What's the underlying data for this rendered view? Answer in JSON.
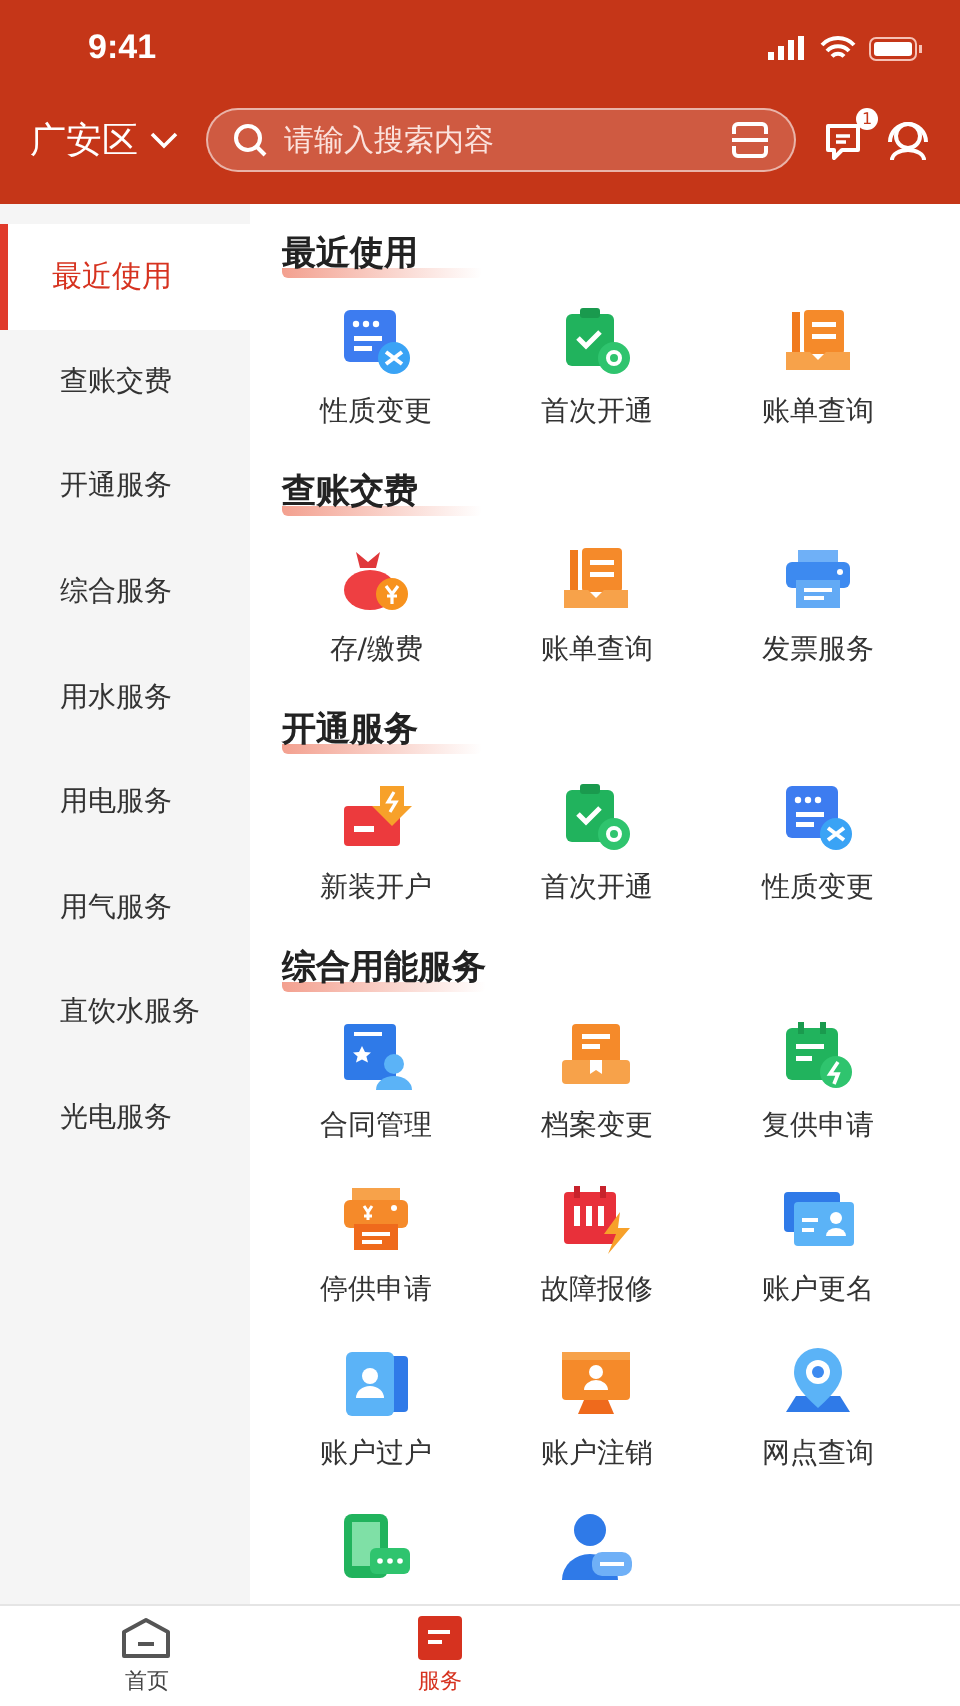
{
  "status_bar": {
    "time": "9:41"
  },
  "header": {
    "location": "广安区",
    "search": {
      "placeholder": "请输入搜索内容"
    },
    "message_badge": "1"
  },
  "sidebar": {
    "items": [
      {
        "label": "最近使用",
        "selected": true
      },
      {
        "label": "查账交费",
        "selected": false
      },
      {
        "label": "开通服务",
        "selected": false
      },
      {
        "label": "综合服务",
        "selected": false
      },
      {
        "label": "用水服务",
        "selected": false
      },
      {
        "label": "用电服务",
        "selected": false
      },
      {
        "label": "用气服务",
        "selected": false
      },
      {
        "label": "直饮水服务",
        "selected": false
      },
      {
        "label": "光电服务",
        "selected": false
      }
    ]
  },
  "sections": [
    {
      "title": "最近使用",
      "items": [
        {
          "label": "性质变更",
          "kind": "swap"
        },
        {
          "label": "首次开通",
          "kind": "clipboard"
        },
        {
          "label": "账单查询",
          "kind": "tray"
        }
      ]
    },
    {
      "title": "查账交费",
      "items": [
        {
          "label": "存/缴费",
          "kind": "moneybag"
        },
        {
          "label": "账单查询",
          "kind": "tray"
        },
        {
          "label": "发票服务",
          "kind": "printer"
        }
      ]
    },
    {
      "title": "开通服务",
      "items": [
        {
          "label": "新装开户",
          "kind": "newbox"
        },
        {
          "label": "首次开通",
          "kind": "clipboard"
        },
        {
          "label": "性质变更",
          "kind": "swap"
        }
      ]
    },
    {
      "title": "综合用能服务",
      "items": [
        {
          "label": "合同管理",
          "kind": "contract"
        },
        {
          "label": "档案变更",
          "kind": "archive"
        },
        {
          "label": "复供申请",
          "kind": "calendar"
        },
        {
          "label": "停供申请",
          "kind": "billprinter"
        },
        {
          "label": "故障报修",
          "kind": "fault"
        },
        {
          "label": "账户更名",
          "kind": "idcard"
        },
        {
          "label": "账户过户",
          "kind": "transfer"
        },
        {
          "label": "账户注销",
          "kind": "monitor"
        },
        {
          "label": "网点查询",
          "kind": "location"
        },
        {
          "kind": "phonechat"
        },
        {
          "kind": "userchat"
        }
      ]
    }
  ],
  "tabbar": {
    "items": [
      {
        "label": "首页",
        "kind": "home",
        "selected": false
      },
      {
        "label": "服务",
        "kind": "service",
        "selected": true
      }
    ]
  }
}
